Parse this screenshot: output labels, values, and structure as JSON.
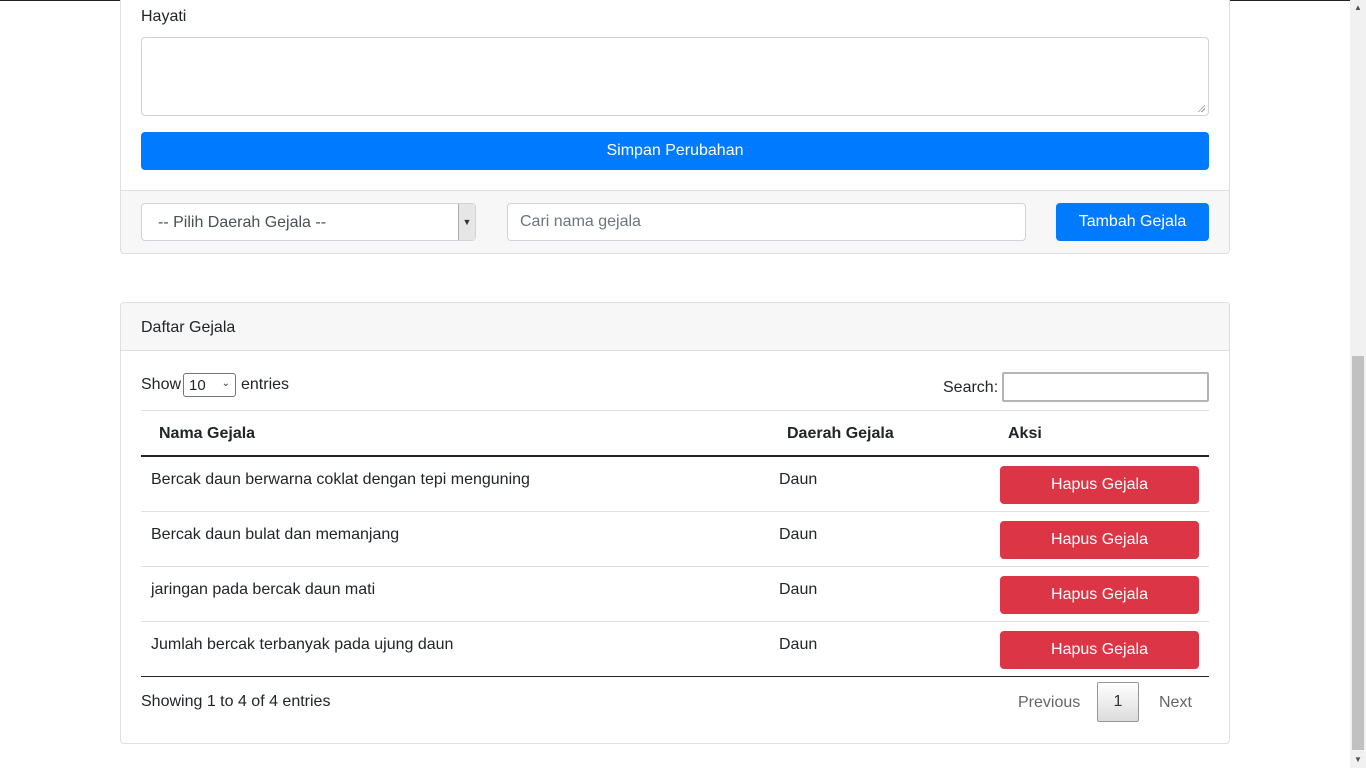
{
  "form": {
    "hayati_label": "Hayati",
    "save_label": "Simpan Perubahan"
  },
  "filter": {
    "daerah_selected": "-- Pilih Daerah Gejala --",
    "search_placeholder": "Cari nama gejala",
    "add_label": "Tambah Gejala"
  },
  "list": {
    "title": "Daftar Gejala",
    "show_label": "Show",
    "page_size": "10",
    "entries_label": "entries",
    "search_label": "Search:",
    "columns": [
      "Nama Gejala",
      "Daerah Gejala",
      "Aksi"
    ],
    "rows": [
      {
        "nama": "Bercak daun berwarna coklat dengan tepi menguning",
        "daerah": "Daun",
        "aksi": "Hapus Gejala"
      },
      {
        "nama": "Bercak daun bulat dan memanjang",
        "daerah": "Daun",
        "aksi": "Hapus Gejala"
      },
      {
        "nama": "jaringan pada bercak daun mati",
        "daerah": "Daun",
        "aksi": "Hapus Gejala"
      },
      {
        "nama": "Jumlah bercak terbanyak pada ujung daun",
        "daerah": "Daun",
        "aksi": "Hapus Gejala"
      }
    ],
    "info": "Showing 1 to 4 of 4 entries",
    "pagination": {
      "previous": "Previous",
      "current": "1",
      "next": "Next"
    }
  },
  "colors": {
    "primary": "#007bff",
    "danger": "#dc3545"
  }
}
